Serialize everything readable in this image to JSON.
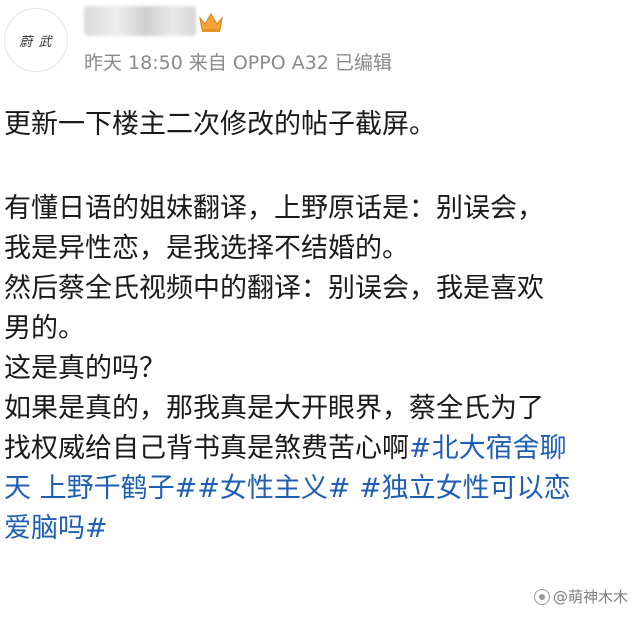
{
  "post": {
    "author": {
      "avatar_text": "蔚 武",
      "badge_icon": "crown-icon"
    },
    "meta": {
      "time": "昨天 18:50",
      "source": "来自 OPPO A32",
      "edited": "已编辑"
    },
    "lines": {
      "l1": "更新一下楼主二次修改的帖子截屏。",
      "l2": "有懂日语的姐妹翻译，上野原话是：别误会，",
      "l3": "我是异性恋，是我选择不结婚的。",
      "l4": "然后蔡全氏视频中的翻译：别误会，我是喜欢",
      "l5": "男的。",
      "l6": "这是真的吗？",
      "l7": "如果是真的，那我真是大开眼界，蔡全氏为了",
      "l8_text": "找权威给自己背书真是煞费苦心啊",
      "l8_tag": "#北大宿舍聊",
      "l9_tag_a": "天 上野千鹤子#",
      "l9_tag_b": "#女性主义#",
      "l9_tag_c": "#独立女性可以恋",
      "l10_tag": "爱脑吗#"
    },
    "tag_color": "#1f5fb3"
  },
  "watermark": {
    "label": "@萌神木木"
  }
}
